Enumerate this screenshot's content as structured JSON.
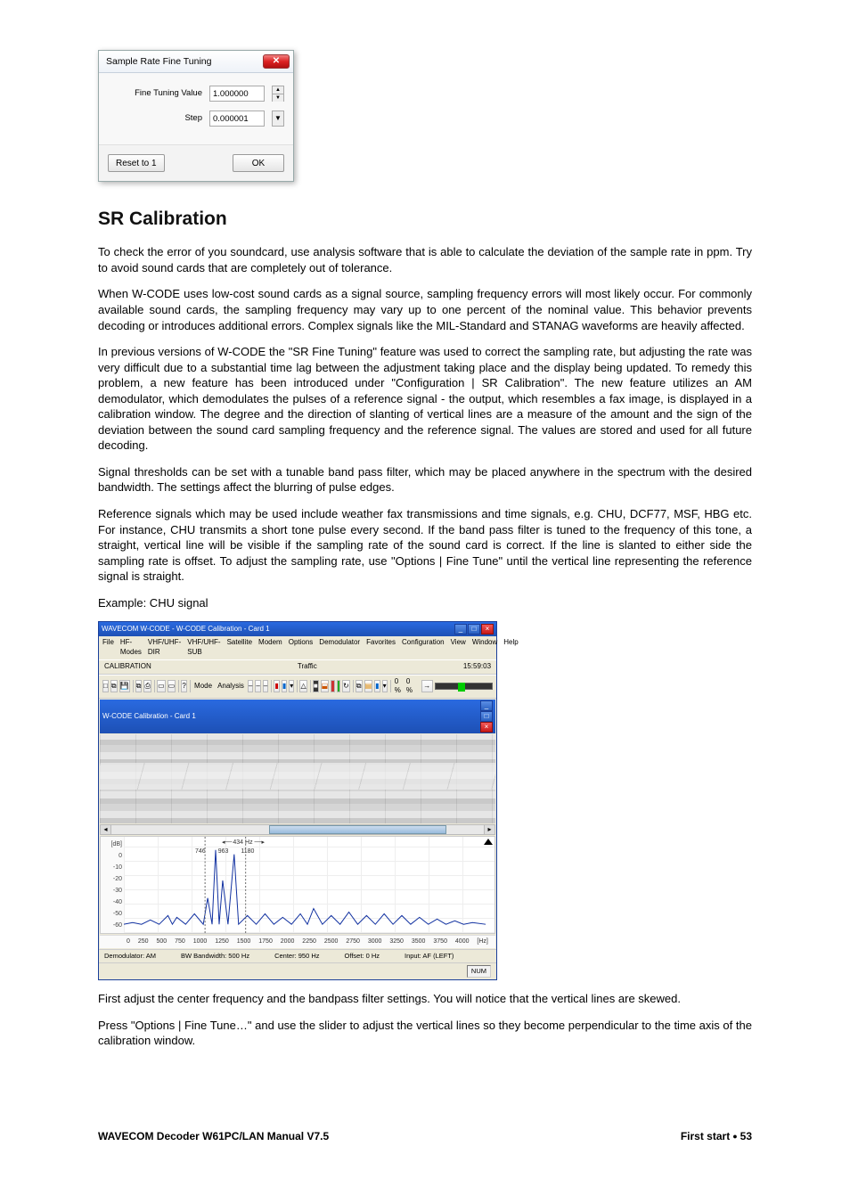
{
  "dialog": {
    "title": "Sample Rate Fine Tuning",
    "field1_label": "Fine Tuning Value",
    "field1_value": "1.000000",
    "field2_label": "Step",
    "field2_value": "0.000001",
    "reset": "Reset to 1",
    "ok": "OK"
  },
  "section_heading": "SR Calibration",
  "paragraphs": {
    "p1": "To check the error of you soundcard, use analysis software that is able to calculate the deviation of the sample rate in ppm. Try to avoid sound cards that are completely out of tolerance.",
    "p2": "When W-CODE uses low-cost sound cards as a signal source, sampling frequency errors will most likely occur. For commonly available sound cards, the sampling frequency may vary up to one percent of the nominal value. This behavior prevents decoding or introduces additional errors. Complex signals like the MIL-Standard and STANAG waveforms are heavily affected.",
    "p3": "In previous versions of W-CODE the \"SR Fine Tuning\" feature was used to correct the sampling rate, but adjusting the rate was very difficult due to a substantial time lag between the adjustment taking place and the display being updated. To remedy this problem, a new feature has been introduced under \"Configuration | SR Calibration\". The new feature utilizes an AM demodulator, which demodulates the pulses of a reference signal - the output, which resembles a fax image, is displayed in a calibration window. The degree and the direction of slanting of vertical lines are a measure of the amount and the sign of the deviation between the sound card sampling frequency and the reference signal. The values are stored and used for all future decoding.",
    "p4": "Signal thresholds can be set with a tunable band pass filter, which may be placed anywhere in the spectrum with the desired bandwidth. The settings affect the blurring of pulse edges.",
    "p5": "Reference signals which may be used include weather fax transmissions and time signals, e.g. CHU, DCF77, MSF, HBG etc. For instance, CHU transmits a short tone pulse every second. If the band pass filter is tuned to the frequency of this tone, a straight, vertical line will be visible if the sampling rate of the sound card is correct. If the line is slanted to either side the sampling rate is offset. To adjust the sampling rate, use \"Options | Fine Tune\" until the vertical line representing the reference signal is straight.",
    "example": "Example: CHU signal",
    "p6": "First adjust the center frequency and the bandpass filter settings. You will notice that the vertical lines are skewed.",
    "p7": "Press \"Options | Fine Tune…\" and use the slider to adjust the vertical lines so they become perpendicular to the time axis of the calibration window."
  },
  "app": {
    "title": "WAVECOM W-CODE  - W-CODE Calibration - Card 1",
    "inner_title": "W-CODE Calibration - Card 1",
    "menu": [
      "File",
      "HF-Modes",
      "VHF/UHF-DIR",
      "VHF/UHF-SUB",
      "Satellite",
      "Modem",
      "Options",
      "Demodulator",
      "Favorites",
      "Configuration",
      "View",
      "Window",
      "Help"
    ],
    "toolbar_left": "CALIBRATION",
    "toolbar_mode": "Mode",
    "toolbar_analysis": "Analysis",
    "traffic_label": "Traffic",
    "time": "15:59:03",
    "pct": "0 %",
    "pct2": "0 %",
    "freq_width_label": "434 Hz",
    "cursor_ticks": [
      "746",
      "963",
      "1180"
    ],
    "y_ticks": [
      "[dB]",
      "0",
      "-10",
      "-20",
      "-30",
      "-40",
      "-50",
      "-60"
    ],
    "x_ticks": [
      "0",
      "250",
      "500",
      "750",
      "1000",
      "1250",
      "1500",
      "1750",
      "2000",
      "2250",
      "2500",
      "2750",
      "3000",
      "3250",
      "3500",
      "3750",
      "4000",
      "[Hz]"
    ],
    "status": {
      "demod": "Demodulator: AM",
      "bw": "BW Bandwidth: 500 Hz",
      "center": "Center: 950 Hz",
      "offset": "Offset: 0 Hz",
      "input": "Input: AF (LEFT)",
      "num": "NUM"
    }
  },
  "footer": {
    "left": "WAVECOM Decoder W61PC/LAN Manual V7.5",
    "right_label": "First start",
    "page": "53"
  }
}
